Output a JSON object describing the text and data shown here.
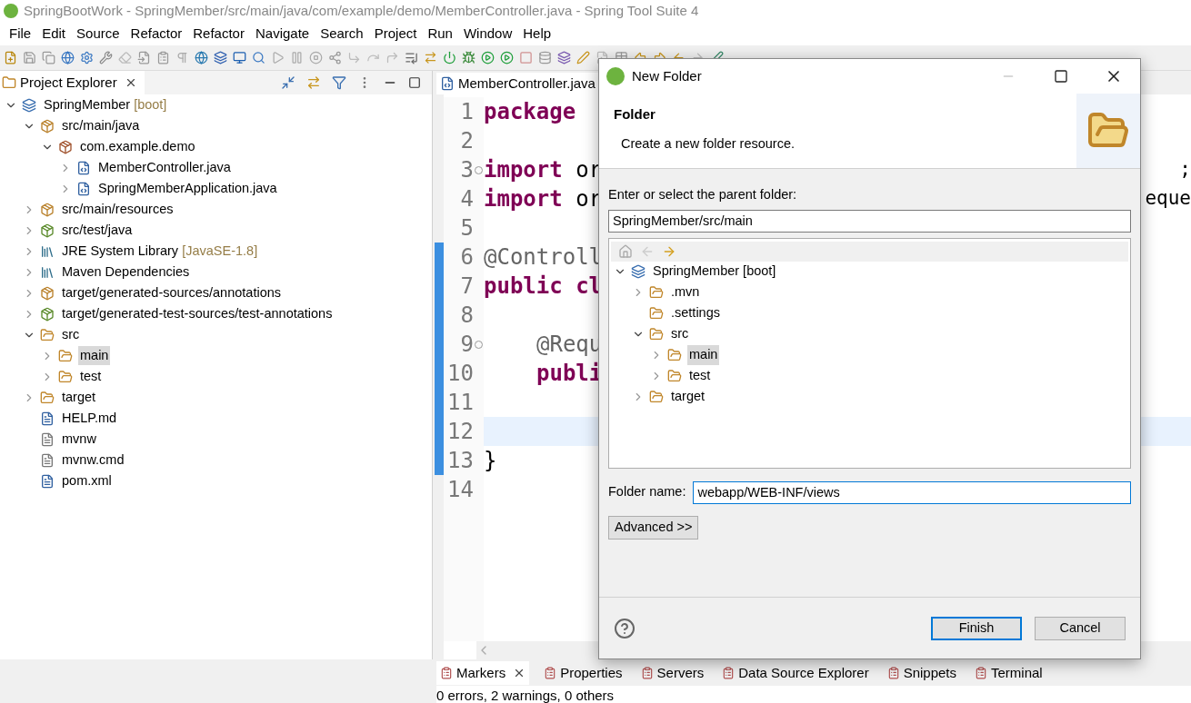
{
  "window": {
    "title": "SpringBootWork - SpringMember/src/main/java/com/example/demo/MemberController.java - Spring Tool Suite 4"
  },
  "menu": [
    "File",
    "Edit",
    "Source",
    "Refactor",
    "Refactor",
    "Navigate",
    "Search",
    "Project",
    "Run",
    "Window",
    "Help"
  ],
  "project_explorer": {
    "title": "Project Explorer",
    "tree": [
      {
        "label": "SpringMember",
        "decoration": "[boot]",
        "kind": "project",
        "expanded": true,
        "selected": false,
        "children": [
          {
            "label": "src/main/java",
            "kind": "source-folder",
            "expanded": true,
            "selected": false,
            "children": [
              {
                "label": "com.example.demo",
                "kind": "package",
                "expanded": true,
                "selected": false,
                "children": [
                  {
                    "label": "MemberController.java",
                    "kind": "java",
                    "expanded": false,
                    "selected": false
                  },
                  {
                    "label": "SpringMemberApplication.java",
                    "kind": "java",
                    "expanded": false,
                    "selected": false
                  }
                ]
              }
            ]
          },
          {
            "label": "src/main/resources",
            "kind": "source-folder",
            "expanded": false,
            "selected": false
          },
          {
            "label": "src/test/java",
            "kind": "test-folder",
            "expanded": false,
            "selected": false
          },
          {
            "label": "JRE System Library",
            "decoration": "[JavaSE-1.8]",
            "kind": "library",
            "expanded": false,
            "selected": false
          },
          {
            "label": "Maven Dependencies",
            "kind": "library",
            "expanded": false,
            "selected": false
          },
          {
            "label": "target/generated-sources/annotations",
            "kind": "source-folder",
            "expanded": false,
            "selected": false
          },
          {
            "label": "target/generated-test-sources/test-annotations",
            "kind": "test-folder",
            "expanded": false,
            "selected": false
          },
          {
            "label": "src",
            "kind": "folder",
            "expanded": true,
            "selected": false,
            "children": [
              {
                "label": "main",
                "kind": "folder",
                "expanded": false,
                "selected": true
              },
              {
                "label": "test",
                "kind": "folder",
                "expanded": false,
                "selected": false
              }
            ]
          },
          {
            "label": "target",
            "kind": "folder",
            "expanded": false,
            "selected": false
          },
          {
            "label": "HELP.md",
            "kind": "doc",
            "selected": false
          },
          {
            "label": "mvnw",
            "kind": "text",
            "selected": false
          },
          {
            "label": "mvnw.cmd",
            "kind": "text",
            "selected": false
          },
          {
            "label": "pom.xml",
            "kind": "maven",
            "selected": false
          }
        ]
      }
    ]
  },
  "editor": {
    "tab": "MemberController.java",
    "lines": [
      {
        "number": "1",
        "changed": false,
        "current": false,
        "fold": false,
        "indented": false,
        "segments": [
          {
            "text": "package",
            "kind": "keyword"
          }
        ]
      },
      {
        "number": "2",
        "changed": false,
        "current": false,
        "fold": false
      },
      {
        "number": "3",
        "changed": false,
        "current": false,
        "fold": true,
        "indented": false,
        "segments": [
          {
            "text": "import",
            "kind": "keyword"
          },
          {
            "text": " or",
            "kind": "plain"
          }
        ],
        "right": ";"
      },
      {
        "number": "4",
        "changed": false,
        "current": false,
        "fold": false,
        "indented": false,
        "segments": [
          {
            "text": "import",
            "kind": "keyword"
          },
          {
            "text": " or",
            "kind": "plain"
          }
        ],
        "right": "eque"
      },
      {
        "number": "5",
        "changed": false,
        "current": false,
        "fold": false
      },
      {
        "number": "6",
        "changed": true,
        "current": false,
        "fold": false,
        "indented": false,
        "segments": [
          {
            "text": "@Controll",
            "kind": "annotation"
          }
        ]
      },
      {
        "number": "7",
        "changed": true,
        "current": false,
        "fold": false,
        "indented": false,
        "segments": [
          {
            "text": "public cl",
            "kind": "keyword"
          }
        ]
      },
      {
        "number": "8",
        "changed": true,
        "current": false,
        "fold": false
      },
      {
        "number": "9",
        "changed": true,
        "current": false,
        "fold": true,
        "indented": true,
        "segments": [
          {
            "text": "@Requ",
            "kind": "annotation"
          }
        ]
      },
      {
        "number": "10",
        "changed": true,
        "current": false,
        "fold": false,
        "indented": true,
        "segments": [
          {
            "text": "publi",
            "kind": "keyword"
          }
        ]
      },
      {
        "number": "11",
        "changed": true,
        "current": false,
        "fold": false
      },
      {
        "number": "12",
        "changed": true,
        "current": true,
        "fold": false
      },
      {
        "number": "13",
        "changed": true,
        "current": false,
        "fold": false,
        "indented": false,
        "segments": [
          {
            "text": "}",
            "kind": "plain"
          }
        ]
      },
      {
        "number": "14",
        "changed": false,
        "current": false,
        "fold": false
      }
    ]
  },
  "dialog": {
    "title": "New Folder",
    "heading": "Folder",
    "description": "Create a new folder resource.",
    "parent_label": "Enter or select the parent folder:",
    "parent_value": "SpringMember/src/main",
    "tree": [
      {
        "label": "SpringMember [boot]",
        "kind": "project",
        "expanded": true,
        "selected": false,
        "children": [
          {
            "label": ".mvn",
            "kind": "folder",
            "expanded": false,
            "selected": false
          },
          {
            "label": ".settings",
            "kind": "folder",
            "selected": false
          },
          {
            "label": "src",
            "kind": "folder",
            "expanded": true,
            "selected": false,
            "children": [
              {
                "label": "main",
                "kind": "folder",
                "expanded": false,
                "selected": true
              },
              {
                "label": "test",
                "kind": "folder",
                "expanded": false,
                "selected": false
              }
            ]
          },
          {
            "label": "target",
            "kind": "folder",
            "expanded": false,
            "selected": false
          }
        ]
      }
    ],
    "folder_name_label": "Folder name:",
    "folder_name_value": "webapp/WEB-INF/views",
    "advanced": "Advanced >>",
    "buttons": [
      {
        "label": "Finish",
        "default": true
      },
      {
        "label": "Cancel",
        "default": false
      }
    ]
  },
  "bottom_panel": {
    "tabs": [
      {
        "label": "Markers",
        "selected": true
      },
      {
        "label": "Properties",
        "selected": false
      },
      {
        "label": "Servers",
        "selected": false
      },
      {
        "label": "Data Source Explorer",
        "selected": false
      },
      {
        "label": "Snippets",
        "selected": false
      },
      {
        "label": "Terminal",
        "selected": false
      }
    ],
    "status": "0 errors, 2 warnings, 0 others"
  }
}
